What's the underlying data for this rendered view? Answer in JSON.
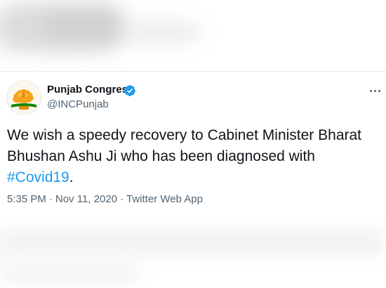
{
  "tweet": {
    "author_name": "Punjab Congress",
    "handle": "@INCPunjab",
    "text_main": "We wish a speedy recovery to Cabinet Minister Bharat Bhushan Ashu Ji who has been diagnosed with ",
    "hashtag": "#Covid19",
    "text_end": ".",
    "time": "5:35 PM",
    "date": "Nov 11, 2020",
    "source": "Twitter Web App",
    "separator": "·",
    "avatar_icon": "punjab-congress-logo-icon",
    "verified_icon": "verified-badge-icon",
    "more_icon": "more-options-icon"
  },
  "colors": {
    "link": "#1d9bf0",
    "text": "#0f1419",
    "muted": "#536471",
    "verified": "#1d9bf0",
    "avatar_saffron": "#f6a11b",
    "avatar_green": "#138808"
  }
}
